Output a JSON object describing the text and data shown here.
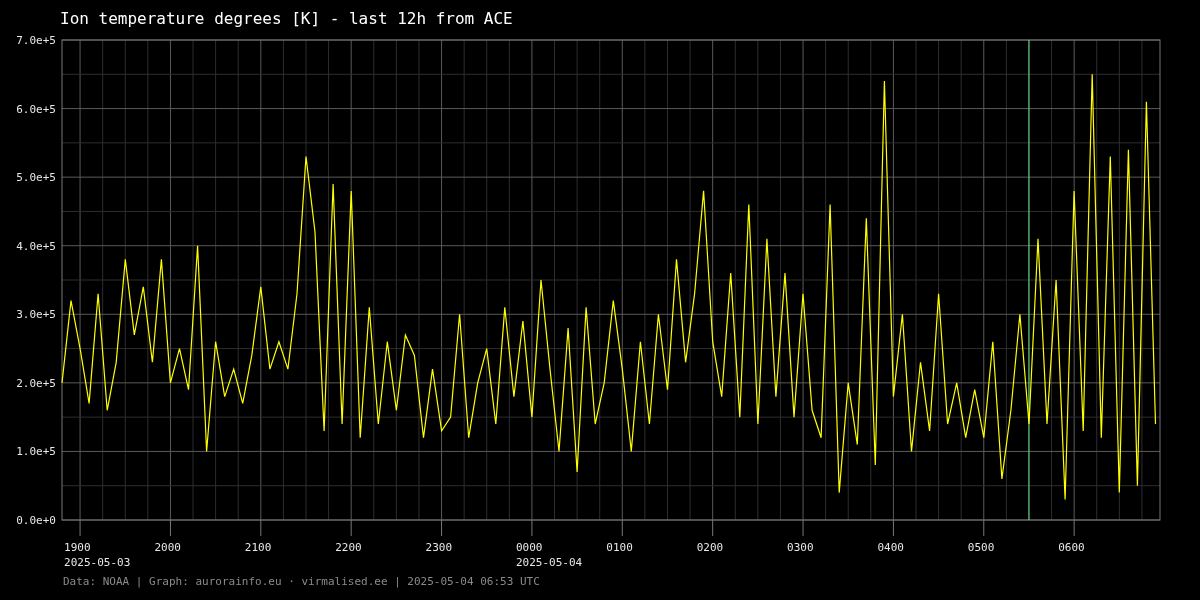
{
  "chart": {
    "chart_data": {
      "type": "line",
      "title": "Ion temperature degrees [K] - last 12h from ACE",
      "categories": [
        null,
        null,
        "1900",
        null,
        null,
        null,
        null,
        null,
        null,
        null,
        null,
        null,
        "2000",
        null,
        null,
        null,
        null,
        null,
        null,
        null,
        null,
        null,
        "2100",
        null,
        null,
        null,
        null,
        null,
        null,
        null,
        null,
        null,
        "2200",
        null,
        null,
        null,
        null,
        null,
        null,
        null,
        null,
        null,
        "2300",
        null,
        null,
        null,
        null,
        null,
        null,
        null,
        null,
        null,
        "0000",
        null,
        null,
        null,
        null,
        null,
        null,
        null,
        null,
        null,
        "0100",
        null,
        null,
        null,
        null,
        null,
        null,
        null,
        null,
        null,
        "0200",
        null,
        null,
        null,
        null,
        null,
        null,
        null,
        null,
        null,
        "0300",
        null,
        null,
        null,
        null,
        null,
        null,
        null,
        null,
        null,
        "0400",
        null,
        null,
        null,
        null,
        null,
        null,
        null,
        null,
        null,
        "0500",
        null,
        null,
        null,
        null,
        null,
        null,
        null,
        null,
        null,
        "0600",
        null,
        null,
        null,
        null,
        null,
        null,
        null,
        null,
        null
      ],
      "series": [
        {
          "color": "#ffff00",
          "values": [
            200000,
            320000,
            250000,
            170000,
            330000,
            160000,
            230000,
            380000,
            270000,
            340000,
            230000,
            380000,
            200000,
            250000,
            190000,
            400000,
            100000,
            260000,
            180000,
            220000,
            170000,
            240000,
            340000,
            220000,
            260000,
            220000,
            330000,
            530000,
            420000,
            130000,
            490000,
            140000,
            480000,
            120000,
            310000,
            140000,
            260000,
            160000,
            270000,
            240000,
            120000,
            220000,
            130000,
            150000,
            300000,
            120000,
            200000,
            250000,
            140000,
            310000,
            180000,
            290000,
            150000,
            350000,
            220000,
            100000,
            280000,
            70000,
            310000,
            140000,
            200000,
            320000,
            220000,
            100000,
            260000,
            140000,
            300000,
            190000,
            380000,
            230000,
            330000,
            480000,
            260000,
            180000,
            360000,
            150000,
            460000,
            140000,
            410000,
            180000,
            360000,
            150000,
            330000,
            160000,
            120000,
            460000,
            40000,
            200000,
            110000,
            440000,
            80000,
            640000,
            180000,
            300000,
            100000,
            230000,
            130000,
            330000,
            140000,
            200000,
            120000,
            190000,
            120000,
            260000,
            60000,
            160000,
            300000,
            140000,
            410000,
            140000,
            350000,
            30000,
            480000,
            130000,
            650000,
            120000,
            530000,
            40000,
            540000,
            50000,
            610000,
            140000
          ]
        }
      ],
      "ylim": [
        0,
        700000
      ],
      "grid": true,
      "yticks": [
        {
          "value": 0,
          "label": "0.0e+0"
        },
        {
          "value": 100000,
          "label": "1.0e+5"
        },
        {
          "value": 200000,
          "label": "2.0e+5"
        },
        {
          "value": 300000,
          "label": "3.0e+5"
        },
        {
          "value": 400000,
          "label": "4.0e+5"
        },
        {
          "value": 500000,
          "label": "5.0e+5"
        },
        {
          "value": 600000,
          "label": "6.0e+5"
        },
        {
          "value": 700000,
          "label": "7.0e+5"
        }
      ]
    },
    "date_labels": [
      "2025-05-03",
      "2025-05-04"
    ]
  },
  "footer": {
    "text": "Data: NOAA | Graph: aurorainfo.eu · virmalised.ee | 2025-05-04 06:53 UTC"
  }
}
